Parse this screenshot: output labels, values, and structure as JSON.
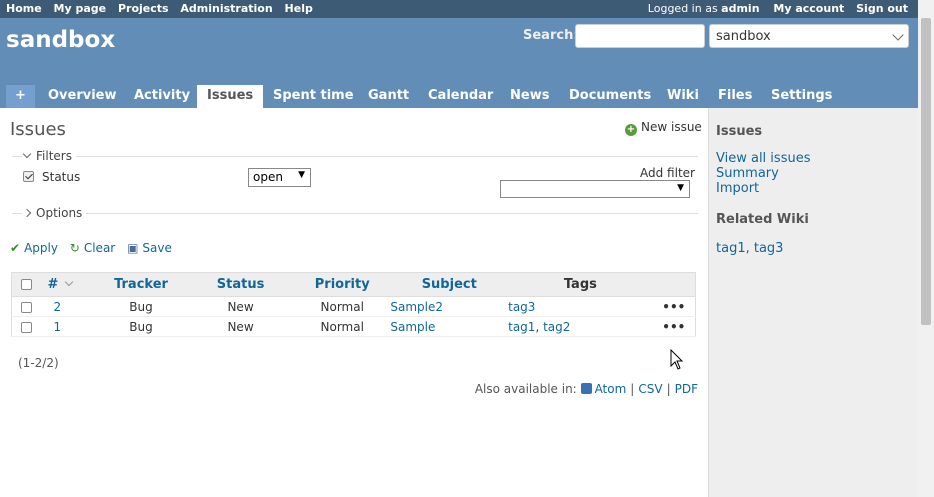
{
  "top_menu": {
    "left": [
      "Home",
      "My page",
      "Projects",
      "Administration",
      "Help"
    ],
    "logged_in_prefix": "Logged in as",
    "user": "admin",
    "my_account": "My account",
    "sign_out": "Sign out"
  },
  "header": {
    "project": "sandbox",
    "search_label": "Search:",
    "search_value": "",
    "project_jump": "sandbox"
  },
  "main_menu": {
    "plus": "+",
    "tabs": [
      "Overview",
      "Activity",
      "Issues",
      "Spent time",
      "Gantt",
      "Calendar",
      "News",
      "Documents",
      "Wiki",
      "Files",
      "Settings"
    ],
    "selected": "Issues"
  },
  "content": {
    "title": "Issues",
    "new_issue": "New issue",
    "filters_legend": "Filters",
    "status_filter_label": "Status",
    "status_operator": "open",
    "add_filter_label": "Add filter",
    "add_filter_value": "",
    "options_legend": "Options",
    "apply": "Apply",
    "clear": "Clear",
    "save": "Save",
    "columns": [
      "#",
      "Tracker",
      "Status",
      "Priority",
      "Subject",
      "Tags"
    ],
    "rows": [
      {
        "id": "2",
        "tracker": "Bug",
        "status": "New",
        "priority": "Normal",
        "subject": "Sample2",
        "tags": [
          "tag3"
        ]
      },
      {
        "id": "1",
        "tracker": "Bug",
        "status": "New",
        "priority": "Normal",
        "subject": "Sample",
        "tags": [
          "tag1",
          "tag2"
        ]
      }
    ],
    "pagination": "(1-2/2)",
    "also_available": "Also available in:",
    "formats": [
      "Atom",
      "CSV",
      "PDF"
    ]
  },
  "sidebar": {
    "issues_heading": "Issues",
    "links": [
      "View all issues",
      "Summary",
      "Import"
    ],
    "related_wiki_heading": "Related Wiki",
    "wiki_tags": [
      "tag1",
      "tag3"
    ]
  },
  "colors": {
    "top_menu": "#3e5b76",
    "header": "#628db6",
    "link": "#169",
    "sidebar": "#eeeeee"
  }
}
